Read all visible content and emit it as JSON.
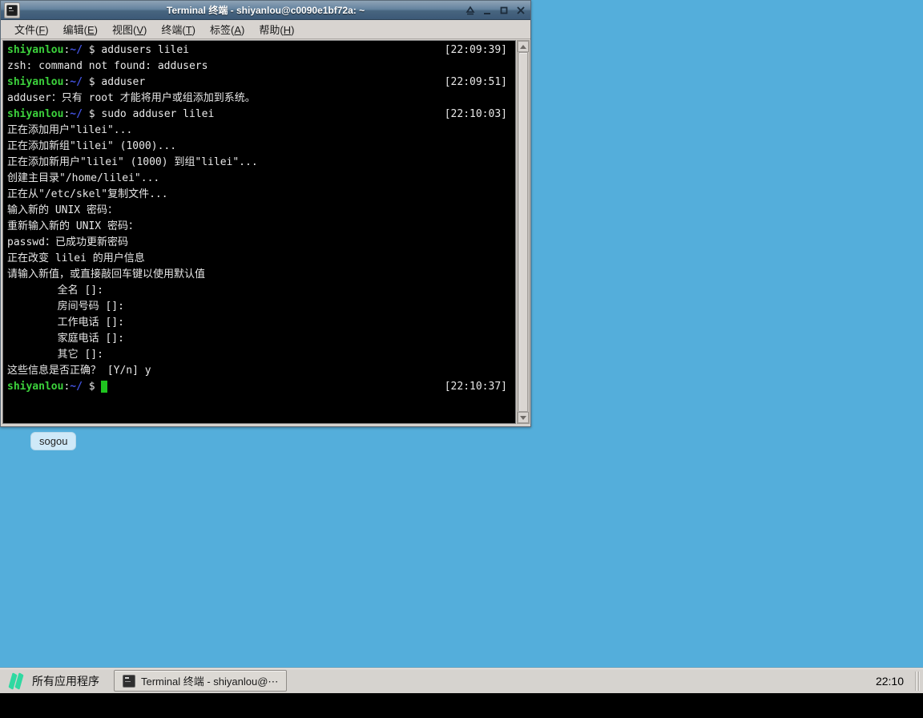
{
  "window": {
    "title": "Terminal 终端 - shiyanlou@c0090e1bf72a: ~",
    "controls": [
      "shade",
      "minimize",
      "maximize",
      "close"
    ]
  },
  "menu": {
    "items": [
      {
        "name": "file",
        "pre": "文件(",
        "key": "F",
        "post": ")"
      },
      {
        "name": "edit",
        "pre": "编辑(",
        "key": "E",
        "post": ")"
      },
      {
        "name": "view",
        "pre": "视图(",
        "key": "V",
        "post": ")"
      },
      {
        "name": "terminal",
        "pre": "终端(",
        "key": "T",
        "post": ")"
      },
      {
        "name": "tabs",
        "pre": "标签(",
        "key": "A",
        "post": ")"
      },
      {
        "name": "help",
        "pre": "帮助(",
        "key": "H",
        "post": ")"
      }
    ]
  },
  "terminal": {
    "colors": {
      "background": "#000000",
      "text": "#e8e8e8",
      "user_green": "#3cd23c",
      "path_blue": "#4353e0",
      "cursor_green": "#1fc41f"
    },
    "lines": [
      {
        "segments": [
          {
            "t": "shiyanlou",
            "c": "user"
          },
          {
            "t": ":",
            "c": "p"
          },
          {
            "t": "~/",
            "c": "path"
          },
          {
            "t": " $ ",
            "c": "p"
          },
          {
            "t": "addusers lilei",
            "c": "p"
          }
        ],
        "right": "[22:09:39]"
      },
      {
        "segments": [
          {
            "t": "zsh: command not found: addusers",
            "c": "p"
          }
        ]
      },
      {
        "segments": [
          {
            "t": "shiyanlou",
            "c": "user"
          },
          {
            "t": ":",
            "c": "p"
          },
          {
            "t": "~/",
            "c": "path"
          },
          {
            "t": " $ ",
            "c": "p"
          },
          {
            "t": "adduser",
            "c": "p"
          }
        ],
        "right": "[22:09:51]"
      },
      {
        "segments": [
          {
            "t": "adduser：只有 root 才能将用户或组添加到系统。",
            "c": "p"
          }
        ]
      },
      {
        "segments": [
          {
            "t": "shiyanlou",
            "c": "user"
          },
          {
            "t": ":",
            "c": "p"
          },
          {
            "t": "~/",
            "c": "path"
          },
          {
            "t": " $ ",
            "c": "p"
          },
          {
            "t": "sudo adduser lilei",
            "c": "p"
          }
        ],
        "right": "[22:10:03]"
      },
      {
        "segments": [
          {
            "t": "正在添加用户\"lilei\"...",
            "c": "p"
          }
        ]
      },
      {
        "segments": [
          {
            "t": "正在添加新组\"lilei\" (1000)...",
            "c": "p"
          }
        ]
      },
      {
        "segments": [
          {
            "t": "正在添加新用户\"lilei\" (1000) 到组\"lilei\"...",
            "c": "p"
          }
        ]
      },
      {
        "segments": [
          {
            "t": "创建主目录\"/home/lilei\"...",
            "c": "p"
          }
        ]
      },
      {
        "segments": [
          {
            "t": "正在从\"/etc/skel\"复制文件...",
            "c": "p"
          }
        ]
      },
      {
        "segments": [
          {
            "t": "输入新的 UNIX 密码：",
            "c": "p"
          }
        ]
      },
      {
        "segments": [
          {
            "t": "重新输入新的 UNIX 密码：",
            "c": "p"
          }
        ]
      },
      {
        "segments": [
          {
            "t": "passwd：已成功更新密码",
            "c": "p"
          }
        ]
      },
      {
        "segments": [
          {
            "t": "正在改变 lilei 的用户信息",
            "c": "p"
          }
        ]
      },
      {
        "segments": [
          {
            "t": "请输入新值，或直接敲回车键以使用默认值",
            "c": "p"
          }
        ]
      },
      {
        "segments": [
          {
            "t": "        全名 []:",
            "c": "p"
          }
        ]
      },
      {
        "segments": [
          {
            "t": "        房间号码 []:",
            "c": "p"
          }
        ]
      },
      {
        "segments": [
          {
            "t": "        工作电话 []:",
            "c": "p"
          }
        ]
      },
      {
        "segments": [
          {
            "t": "        家庭电话 []:",
            "c": "p"
          }
        ]
      },
      {
        "segments": [
          {
            "t": "        其它 []:",
            "c": "p"
          }
        ]
      },
      {
        "segments": [
          {
            "t": "这些信息是否正确？ [Y/n] y",
            "c": "p"
          }
        ]
      },
      {
        "segments": [
          {
            "t": "shiyanlou",
            "c": "user"
          },
          {
            "t": ":",
            "c": "p"
          },
          {
            "t": "~/",
            "c": "path"
          },
          {
            "t": " $ ",
            "c": "p"
          },
          {
            "t": " ",
            "c": "cursor"
          }
        ],
        "right": "[22:10:37]"
      }
    ]
  },
  "desktop": {
    "background_color": "#54aedb",
    "sogou_label": "sogou"
  },
  "taskbar": {
    "logo_color": "#2fd9a1",
    "app_menu_label": "所有应用程序",
    "tasks": [
      {
        "label": "Terminal 终端 - shiyanlou@⋯"
      }
    ],
    "clock": "22:10"
  }
}
